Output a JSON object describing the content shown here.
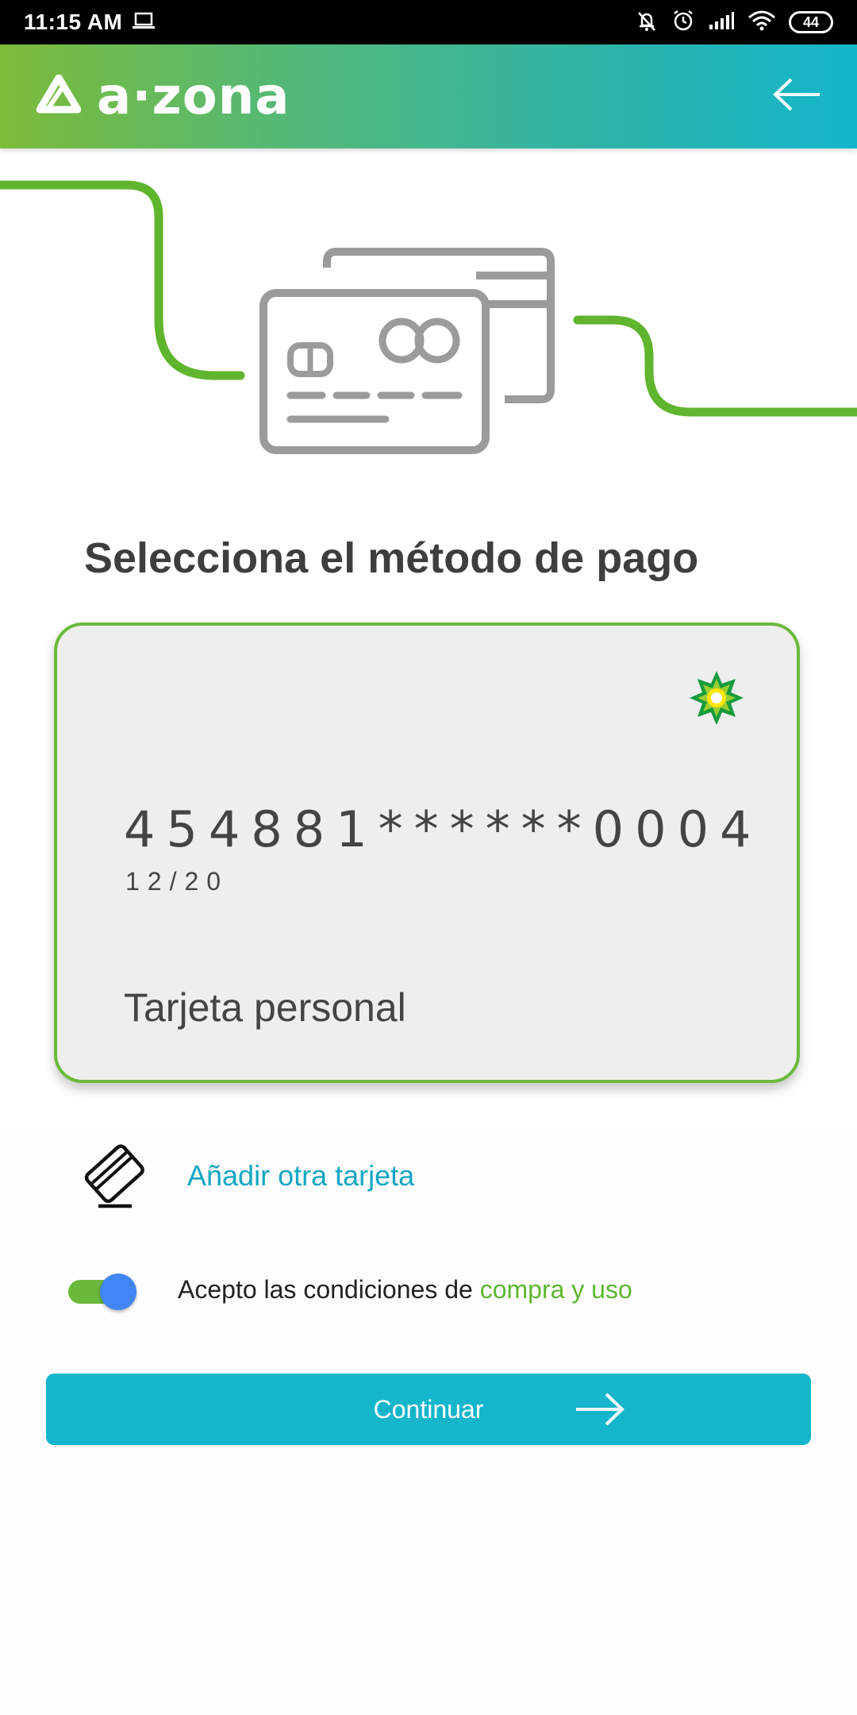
{
  "status_bar": {
    "time": "11:15 AM",
    "battery": "44",
    "icons": [
      "laptop-icon",
      "bell-off-icon",
      "alarm-icon",
      "signal-icon",
      "wifi-icon",
      "battery-icon"
    ]
  },
  "app_bar": {
    "logo_text": "a·zona",
    "back_icon": "arrow-left-icon"
  },
  "page": {
    "heading": "Selecciona el método de pago"
  },
  "card": {
    "number": "454881******0004",
    "expiry": "12/20",
    "label": "Tarjeta personal",
    "brand_icon": "bp-helios-icon"
  },
  "actions": {
    "add_card": "Añadir otra tarjeta",
    "terms_prefix": "Acepto las condiciones de ",
    "terms_link": "compra y uso",
    "terms_accepted": true,
    "continue": "Continuar"
  },
  "colors": {
    "accent_green": "#6bb93b",
    "accent_teal": "#15b5cb",
    "toggle_knob": "#4285f4"
  }
}
